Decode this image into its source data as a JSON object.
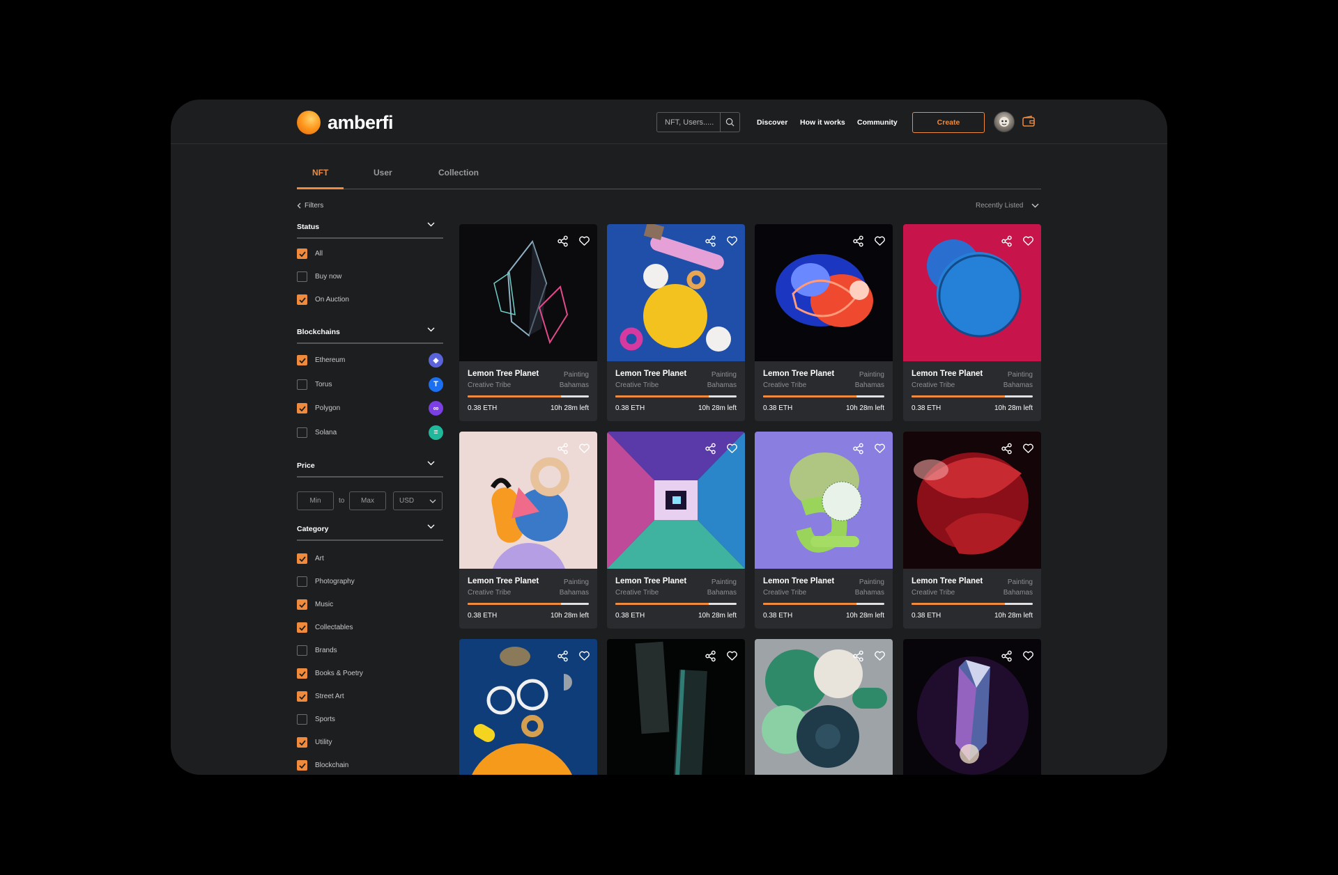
{
  "brand": {
    "name": "amberfi"
  },
  "header": {
    "search_placeholder": "NFT, Users.....",
    "nav": [
      "Discover",
      "How it works",
      "Community"
    ],
    "create_label": "Create"
  },
  "tabs": [
    "NFT",
    "User",
    "Collection"
  ],
  "toolbar": {
    "filters_label": "Filters",
    "sort_label": "Recently Listed"
  },
  "filters": {
    "status": {
      "title": "Status",
      "options": [
        {
          "label": "All",
          "checked": true
        },
        {
          "label": "Buy now",
          "checked": false
        },
        {
          "label": "On Auction",
          "checked": true
        }
      ]
    },
    "blockchains": {
      "title": "Blockchains",
      "options": [
        {
          "label": "Ethereum",
          "checked": true,
          "icon": "ethereum-icon",
          "color": "#5b63d8"
        },
        {
          "label": "Torus",
          "checked": false,
          "icon": "torus-icon",
          "color": "#1a6ff2"
        },
        {
          "label": "Polygon",
          "checked": true,
          "icon": "polygon-icon",
          "color": "#7b3fe4"
        },
        {
          "label": "Solana",
          "checked": false,
          "icon": "solana-icon",
          "color": "#1fb89a"
        }
      ]
    },
    "price": {
      "title": "Price",
      "min_placeholder": "Min",
      "to_label": "to",
      "max_placeholder": "Max",
      "currency": "USD"
    },
    "category": {
      "title": "Category",
      "options": [
        {
          "label": "Art",
          "checked": true
        },
        {
          "label": "Photography",
          "checked": false
        },
        {
          "label": "Music",
          "checked": true
        },
        {
          "label": "Collectables",
          "checked": true
        },
        {
          "label": "Brands",
          "checked": false
        },
        {
          "label": "Books & Poetry",
          "checked": true
        },
        {
          "label": "Street Art",
          "checked": true
        },
        {
          "label": "Sports",
          "checked": false
        },
        {
          "label": "Utility",
          "checked": true
        },
        {
          "label": "Blockchain",
          "checked": true
        }
      ]
    }
  },
  "cards": [
    {
      "title": "Lemon Tree Planet",
      "category": "Painting",
      "creator": "Creative Tribe",
      "location": "Bahamas",
      "price": "0.38 ETH",
      "time_left": "10h 28m left",
      "progress": 0.77,
      "art": "crystal-cluster"
    },
    {
      "title": "Lemon Tree Planet",
      "category": "Painting",
      "creator": "Creative Tribe",
      "location": "Bahamas",
      "price": "0.38 ETH",
      "time_left": "10h 28m left",
      "progress": 0.77,
      "art": "yellow-sphere"
    },
    {
      "title": "Lemon Tree Planet",
      "category": "Painting",
      "creator": "Creative Tribe",
      "location": "Bahamas",
      "price": "0.38 ETH",
      "time_left": "10h 28m left",
      "progress": 0.77,
      "art": "swirl-blob"
    },
    {
      "title": "Lemon Tree Planet",
      "category": "Painting",
      "creator": "Creative Tribe",
      "location": "Bahamas",
      "price": "0.38 ETH",
      "time_left": "10h 28m left",
      "progress": 0.77,
      "art": "blue-discs"
    },
    {
      "title": "Lemon Tree Planet",
      "category": "Painting",
      "creator": "Creative Tribe",
      "location": "Bahamas",
      "price": "0.38 ETH",
      "time_left": "10h 28m left",
      "progress": 0.77,
      "art": "pastel-shapes"
    },
    {
      "title": "Lemon Tree Planet",
      "category": "Painting",
      "creator": "Creative Tribe",
      "location": "Bahamas",
      "price": "0.38 ETH",
      "time_left": "10h 28m left",
      "progress": 0.77,
      "art": "prism-tunnel"
    },
    {
      "title": "Lemon Tree Planet",
      "category": "Painting",
      "creator": "Creative Tribe",
      "location": "Bahamas",
      "price": "0.38 ETH",
      "time_left": "10h 28m left",
      "progress": 0.77,
      "art": "green-spiral"
    },
    {
      "title": "Lemon Tree Planet",
      "category": "Painting",
      "creator": "Creative Tribe",
      "location": "Bahamas",
      "price": "0.38 ETH",
      "time_left": "10h 28m left",
      "progress": 0.77,
      "art": "red-flower"
    },
    {
      "art": "orange-planet"
    },
    {
      "art": "glass-slabs"
    },
    {
      "art": "green-knots"
    },
    {
      "art": "glowing-crystal"
    }
  ],
  "colors": {
    "accent": "#f08a3c",
    "surface": "#1d1e20",
    "card": "#2a2b2e"
  }
}
